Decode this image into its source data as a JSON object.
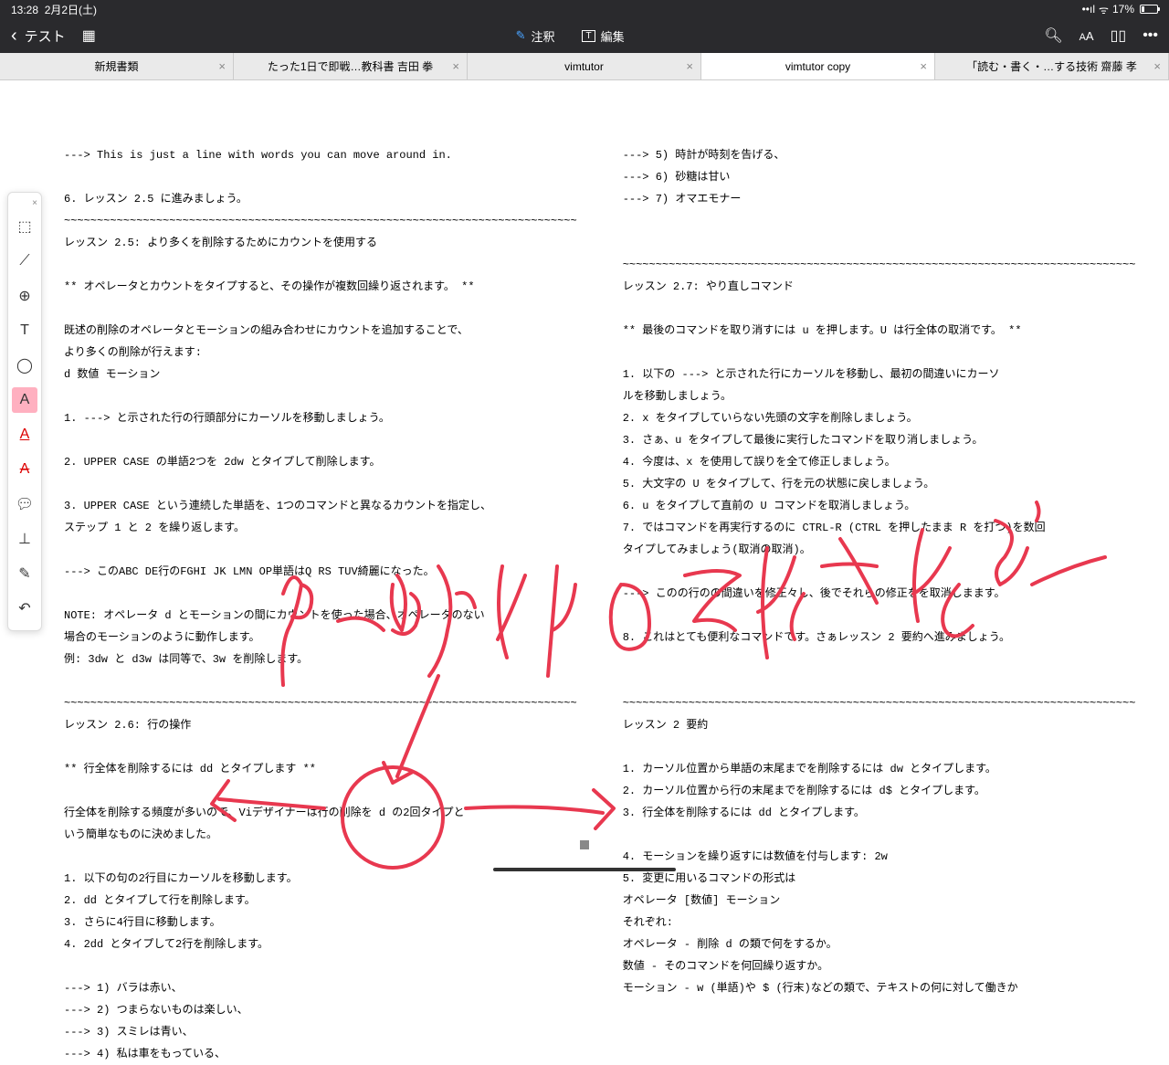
{
  "status": {
    "time": "13:28",
    "date": "2月2日(土)",
    "battery": "17%"
  },
  "topbar": {
    "back": "テスト",
    "annotate": "注釈",
    "edit": "編集"
  },
  "tabs": [
    {
      "label": "新規書類"
    },
    {
      "label": "たった1日で即戦…教科書 吉田 拳"
    },
    {
      "label": "vimtutor"
    },
    {
      "label": "vimtutor copy"
    },
    {
      "label": "「読む・書く・…する技術 齋藤 孝"
    }
  ],
  "left": {
    "l01": "---> This is just a line with words you can move around in.",
    "l02": "  6. レッスン 2.5 に進みましょう。",
    "wave1": "~~~~~~~~~~~~~~~~~~~~~~~~~~~~~~~~~~~~~~~~~~~~~~~~~~~~~~~~~~~~~~~~~~~~~~~~~~~~~~",
    "l03": "             レッスン 2.5: より多くを削除するためにカウントを使用する",
    "l04": "   ** オペレータとカウントをタイプすると、その操作が複数回繰り返されます。 **",
    "l05": "   既述の削除のオペレータとモーションの組み合わせにカウントを追加することで、",
    "l06": "   より多くの削除が行えます:",
    "l07": "         d   数値   モーション",
    "l08": "  1. ---> と示された行の行頭部分にカーソルを移動しましょう。",
    "l09": "  2. UPPER CASE の単語2つを 2dw とタイプして削除します。",
    "l10": "  3. UPPER CASE という連続した単語を、1つのコマンドと異なるカウントを指定し、",
    "l11": "     ステップ 1 と 2 を繰り返します。",
    "l12": "--->  このABC DE行のFGHI JK LMN OP単語はQ RS TUV綺麗になった。",
    "l13": "NOTE:  オペレータ d とモーションの間にカウントを使った場合、オペレータのない",
    "l14": "       場合のモーションのように動作します。",
    "l15": "       例: 3dw と d3w は同等で、3w を削除します。",
    "wave2": "~~~~~~~~~~~~~~~~~~~~~~~~~~~~~~~~~~~~~~~~~~~~~~~~~~~~~~~~~~~~~~~~~~~~~~~~~~~~~~",
    "l16": "                         レッスン 2.6: 行の操作",
    "l17": "               ** 行全体を削除するには dd とタイプします **",
    "l18": "  行全体を削除する頻度が多いので、Viデザイナーは行の削除を d の2回タイプと",
    "l19": "  いう簡単なものに決めました。",
    "l20": "  1. 以下の句の2行目にカーソルを移動します。",
    "l21": "  2. dd とタイプして行を削除します。",
    "l22": "  3. さらに4行目に移動します。",
    "l23": "  4. 2dd とタイプして2行を削除します。",
    "l24": "--->  1)  バラは赤い、",
    "l25": "--->  2)  つまらないものは楽しい、",
    "l26": "--->  3)  スミレは青い、",
    "l27": "--->  4)  私は車をもっている、"
  },
  "right": {
    "r01": "--->  5)  時計が時刻を告げる、",
    "r02": "--->  6)  砂糖は甘い",
    "r03": "--->  7)  オマエモナー",
    "wave1": "~~~~~~~~~~~~~~~~~~~~~~~~~~~~~~~~~~~~~~~~~~~~~~~~~~~~~~~~~~~~~~~~~~~~~~~~~~~~~~",
    "r04": "                    レッスン 2.7: やり直しコマンド",
    "r05": "   ** 最後のコマンドを取り消すには u を押します。U は行全体の取消です。 **",
    "r06": "  1. 以下の ---> と示された行にカーソルを移動し、最初の間違いにカーソ",
    "r07": "     ルを移動しましょう。",
    "r08": "  2. x をタイプしていらない先頭の文字を削除しましょう。",
    "r09": "  3. さぁ、u をタイプして最後に実行したコマンドを取り消しましょう。",
    "r10": "  4. 今度は、x を使用して誤りを全て修正しましょう。",
    "r11": "  5. 大文字の U をタイプして、行を元の状態に戻しましょう。",
    "r12": "  6. u をタイプして直前の U コマンドを取消しましょう。",
    "r13": "  7. ではコマンドを再実行するのに CTRL-R (CTRL を押したまま R を打つ)を数回",
    "r14": "     タイプしてみましょう(取消の取消)。",
    "r15": "---> このの行のの間違いを修正々し、後でそれらの修正をを取消しまます。",
    "r16": "  8. これはとても便利なコマンドです。さぁレッスン 2 要約へ進みましょう。",
    "wave2": "~~~~~~~~~~~~~~~~~~~~~~~~~~~~~~~~~~~~~~~~~~~~~~~~~~~~~~~~~~~~~~~~~~~~~~~~~~~~~~",
    "r17": "                            レッスン 2 要約",
    "r18": "  1. カーソル位置から単語の末尾までを削除するには dw とタイプします。",
    "r19": "  2. カーソル位置から行の末尾までを削除するには d$ とタイプします。",
    "r20": "  3. 行全体を削除するには dd とタイプします。",
    "r21": "  4. モーションを繰り返すには数値を付与します:   2w",
    "r22": "  5. 変更に用いるコマンドの形式は",
    "r23": "               オペレータ   [数値]   モーション",
    "r24": "     それぞれ:",
    "r25": "       オペレータ - 削除 d の類で何をするか。",
    "r26": "       数値       - そのコマンドを何回繰り返すか。",
    "r27": "       モーション - w (単語)や $ (行末)などの類で、テキストの何に対して働きか"
  }
}
